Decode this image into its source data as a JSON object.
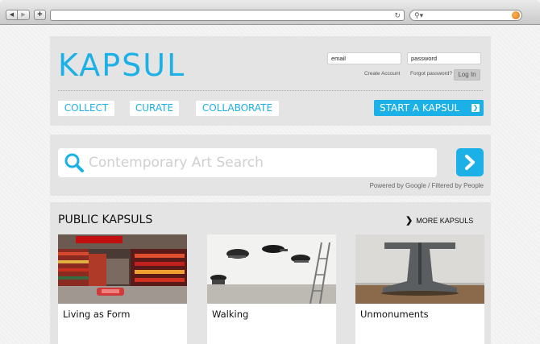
{
  "browser": {
    "back_icon": "back-arrow-icon",
    "forward_icon": "forward-arrow-icon",
    "add_icon": "plus-icon",
    "reload_icon": "reload-icon",
    "search_icon": "magnifier-icon"
  },
  "header": {
    "logo": "KAPSUL",
    "email_value": "email",
    "password_value": "password",
    "create_account": "Create Account",
    "forgot_password": "Forgot password?",
    "login_label": "Log In",
    "tabs": [
      {
        "label": "COLLECT"
      },
      {
        "label": "CURATE"
      },
      {
        "label": "COLLABORATE"
      }
    ],
    "start_label": "START A KAPSUL"
  },
  "search": {
    "placeholder": "Contemporary Art Search",
    "powered_by": "Powered by Google / Filtered by People"
  },
  "public": {
    "title": "PUBLIC KAPSULS",
    "more_label": "MORE KAPSULS",
    "cards": [
      {
        "title": "Living as Form",
        "image": "supermarket-aisle-photo"
      },
      {
        "title": "Walking",
        "image": "gallery-performance-photo"
      },
      {
        "title": "Unmonuments",
        "image": "sculpture-photo"
      }
    ]
  },
  "colors": {
    "accent": "#1bb1e6",
    "panel": "#e4e4e4"
  }
}
